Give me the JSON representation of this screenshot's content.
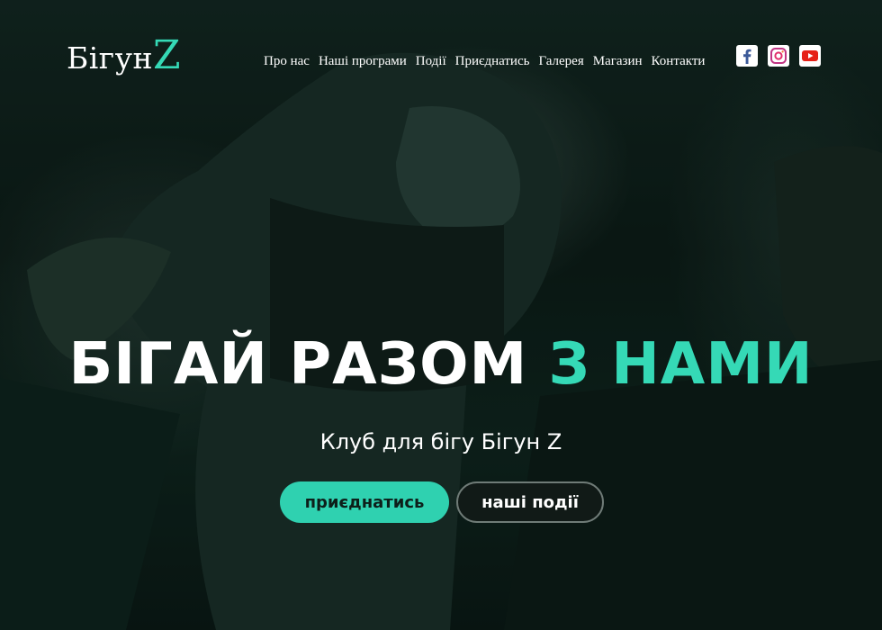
{
  "brand": {
    "name_main": "Бігун",
    "name_accent": "Z",
    "accent_color": "#35d9b6"
  },
  "nav": {
    "items": [
      {
        "label": "Про нас",
        "name": "nav-about"
      },
      {
        "label": "Наші програми",
        "name": "nav-programs"
      },
      {
        "label": "Події",
        "name": "nav-events"
      },
      {
        "label": "Приєднатись",
        "name": "nav-join"
      },
      {
        "label": "Галерея",
        "name": "nav-gallery"
      },
      {
        "label": "Магазин",
        "name": "nav-shop"
      },
      {
        "label": "Контакти",
        "name": "nav-contacts"
      }
    ]
  },
  "social": [
    {
      "icon": "facebook-icon",
      "color": "#3b5998"
    },
    {
      "icon": "instagram-icon",
      "color": "#c13584"
    },
    {
      "icon": "youtube-icon",
      "color": "#e62117"
    }
  ],
  "hero": {
    "title_main": "БІГАЙ РАЗОМ",
    "title_accent": "З НАМИ",
    "subtitle": "Клуб для бігу Бігун Z",
    "primary_button": "приєднатись",
    "secondary_button": "наші події"
  },
  "colors": {
    "primary_button_bg": "#2fd1b0",
    "secondary_button_border": "#6f7b77"
  }
}
